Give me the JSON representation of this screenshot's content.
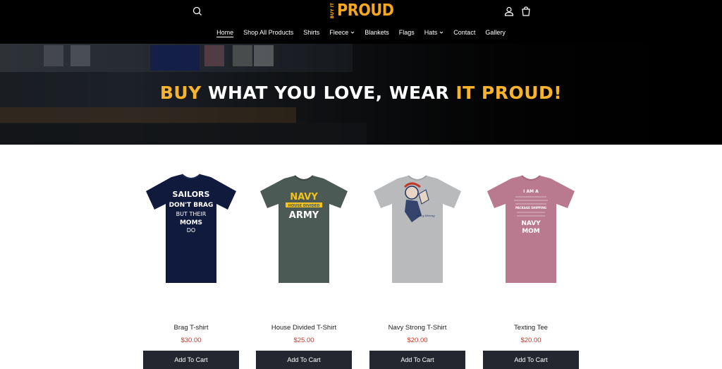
{
  "header": {
    "logo_small": "BUY IT",
    "logo_big": "PROUD",
    "brand_color": "#f6a71e"
  },
  "nav": {
    "items": [
      {
        "label": "Home",
        "active": true
      },
      {
        "label": "Shop All Products"
      },
      {
        "label": "Shirts"
      },
      {
        "label": "Fleece",
        "dropdown": true
      },
      {
        "label": "Blankets"
      },
      {
        "label": "Flags"
      },
      {
        "label": "Hats",
        "dropdown": true
      },
      {
        "label": "Contact"
      },
      {
        "label": "Gallery"
      }
    ]
  },
  "hero": {
    "part1": "BUY",
    "part2": " WHAT YOU LOVE, WEAR ",
    "part3": "IT PROUD!",
    "accent_color": "#f6b32b"
  },
  "products": [
    {
      "name": "Brag T-shirt",
      "price": "$30.00",
      "button": "Add To Cart",
      "shirt_color": "#101a3c",
      "print": [
        "SAILORS",
        "DON'T BRAG",
        "BUT THEIR",
        "MOMS",
        "DO"
      ]
    },
    {
      "name": "House Divided T-Shirt",
      "price": "$25.00",
      "button": "Add To Cart",
      "shirt_color": "#4c5a55",
      "print": [
        "NAVY",
        "HOUSE DIVIDED",
        "ARMY"
      ]
    },
    {
      "name": "Navy Strong T-Shirt",
      "price": "$20.00",
      "button": "Add To Cart",
      "shirt_color": "#b8babc",
      "print": [
        "Navy Strong"
      ]
    },
    {
      "name": "Texting Tee",
      "price": "$20.00",
      "button": "Add To Cart",
      "shirt_color": "#b9798f",
      "print": [
        "I AM A",
        "PACKAGE SHIPPING",
        "NAVY",
        "MOM"
      ]
    }
  ]
}
